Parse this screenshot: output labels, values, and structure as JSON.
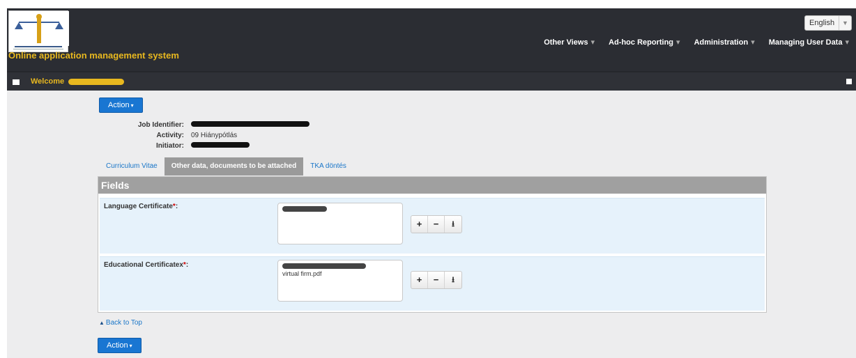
{
  "header": {
    "app_title": "Online application management system",
    "language": "English",
    "menu": [
      {
        "label": "Other Views"
      },
      {
        "label": "Ad-hoc Reporting"
      },
      {
        "label": "Administration"
      },
      {
        "label": "Managing User Data"
      }
    ]
  },
  "welcome": {
    "label": "Welcome"
  },
  "action_top": "Action",
  "action_bottom": "Action",
  "meta": {
    "job_identifier_label": "Job Identifier:",
    "activity_label": "Activity:",
    "activity_value": "09 Hiánypótlás",
    "initiator_label": "Initiator:"
  },
  "tabs": [
    {
      "label": "Curriculum Vitae",
      "active": false
    },
    {
      "label": "Other data, documents to be attached",
      "active": true
    },
    {
      "label": "TKA döntés",
      "active": false
    }
  ],
  "panel": {
    "title": "Fields",
    "fields": [
      {
        "label": "Language Certificate",
        "files": []
      },
      {
        "label": "Educational Certificatex",
        "files": [
          "virtual firm.pdf"
        ]
      }
    ]
  },
  "back_to_top": "Back to Top",
  "colors": {
    "header_bg": "#2b2d33",
    "accent_yellow": "#e8b81f",
    "primary_blue": "#1976d2",
    "field_bg": "#e6f2fb"
  }
}
